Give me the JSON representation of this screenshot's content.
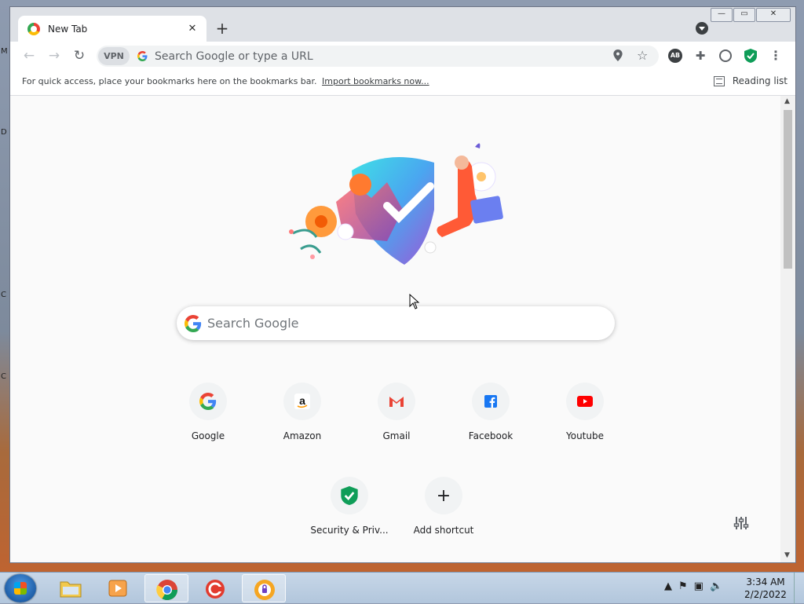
{
  "desktop": {
    "left_letters": [
      "M",
      "D",
      "C",
      "C"
    ]
  },
  "browser": {
    "tab": {
      "title": "New Tab",
      "close": "✕"
    },
    "new_tab": "+",
    "window_buttons": {
      "minimize": "—",
      "maximize": "▭",
      "close": "✕"
    },
    "toolbar": {
      "back": "←",
      "forward": "→",
      "reload": "↻",
      "vpn_label": "VPN",
      "omnibox_placeholder": "Search Google or type a URL"
    },
    "bookmarks_bar": {
      "text": "For quick access, place your bookmarks here on the bookmarks bar.",
      "link": "Import bookmarks now...",
      "reading_list": "Reading list"
    },
    "ntp": {
      "search_placeholder": "Search Google",
      "shortcuts": [
        {
          "label": "Google",
          "icon": "google-icon"
        },
        {
          "label": "Amazon",
          "icon": "amazon-icon"
        },
        {
          "label": "Gmail",
          "icon": "gmail-icon"
        },
        {
          "label": "Facebook",
          "icon": "facebook-icon"
        },
        {
          "label": "Youtube",
          "icon": "youtube-icon"
        },
        {
          "label": "Security & Priv...",
          "icon": "shield-check-icon"
        },
        {
          "label": "Add shortcut",
          "icon": "plus-icon"
        }
      ]
    }
  },
  "taskbar": {
    "clock_time": "3:34 AM",
    "clock_date": "2/2/2022"
  },
  "colors": {
    "accent_blue": "#4285f4",
    "shield_green": "#0f9d58"
  }
}
